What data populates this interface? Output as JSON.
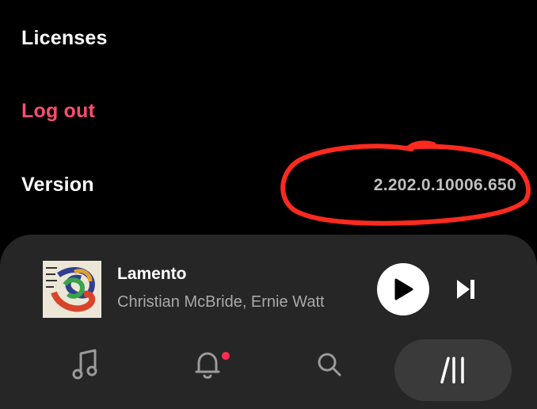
{
  "settings": {
    "licenses_label": "Licenses",
    "logout_label": "Log out",
    "version_label": "Version",
    "version_value": "2.202.0.10006.650"
  },
  "colors": {
    "background": "#000000",
    "logout": "#ff4d6d",
    "annotation": "#ff2a1f",
    "panel": "#262626",
    "notification_dot": "#ff2d55"
  },
  "now_playing": {
    "title": "Lamento",
    "artist": "Christian McBride, Ernie Watt",
    "album_art_icon": "album-cover",
    "play_icon": "play-icon",
    "next_icon": "skip-next-icon"
  },
  "tabs": [
    {
      "name": "music",
      "icon": "music-note-icon"
    },
    {
      "name": "notifications",
      "icon": "bell-icon",
      "has_badge": true
    },
    {
      "name": "search",
      "icon": "search-icon"
    },
    {
      "name": "library",
      "icon": "library-icon",
      "selected": true
    }
  ]
}
